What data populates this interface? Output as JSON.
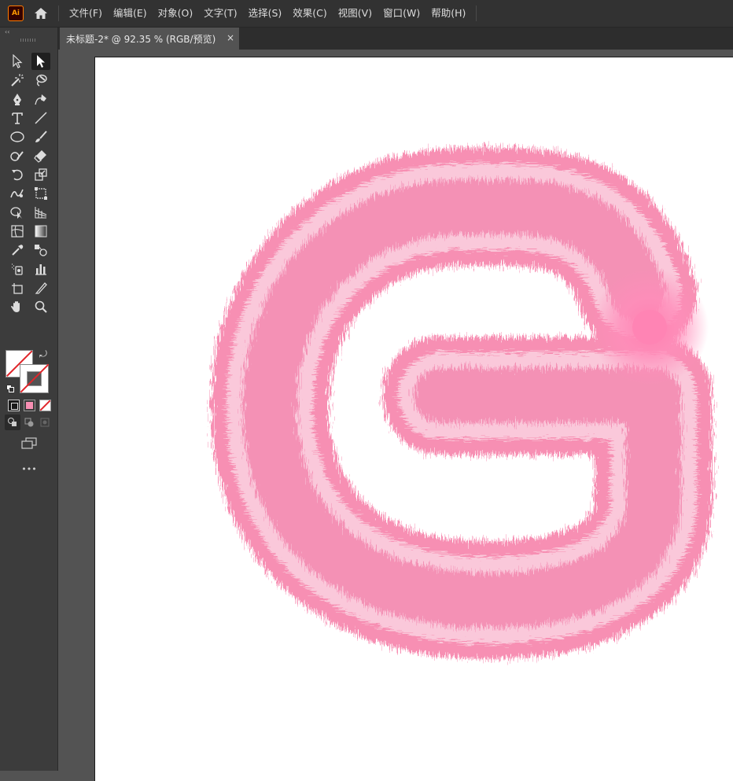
{
  "app": {
    "logo_text": "Ai"
  },
  "menu": {
    "items": [
      "文件(F)",
      "编辑(E)",
      "对象(O)",
      "文字(T)",
      "选择(S)",
      "效果(C)",
      "视图(V)",
      "窗口(W)",
      "帮助(H)"
    ]
  },
  "document_tab": {
    "title": "未标题-2* @ 92.35 % (RGB/预览)",
    "close": "×"
  },
  "tools_panel": {
    "collapse_glyph": "‹‹",
    "more_glyph": "•••",
    "swap_glyph": "⤾"
  },
  "colors": {
    "fur_pink": "#f78fb3",
    "fur_light": "#fbd2e1",
    "ui_dark": "#323232",
    "panel": "#3c3c3c",
    "canvas_bg": "#535353",
    "none_red": "#e0262b"
  }
}
